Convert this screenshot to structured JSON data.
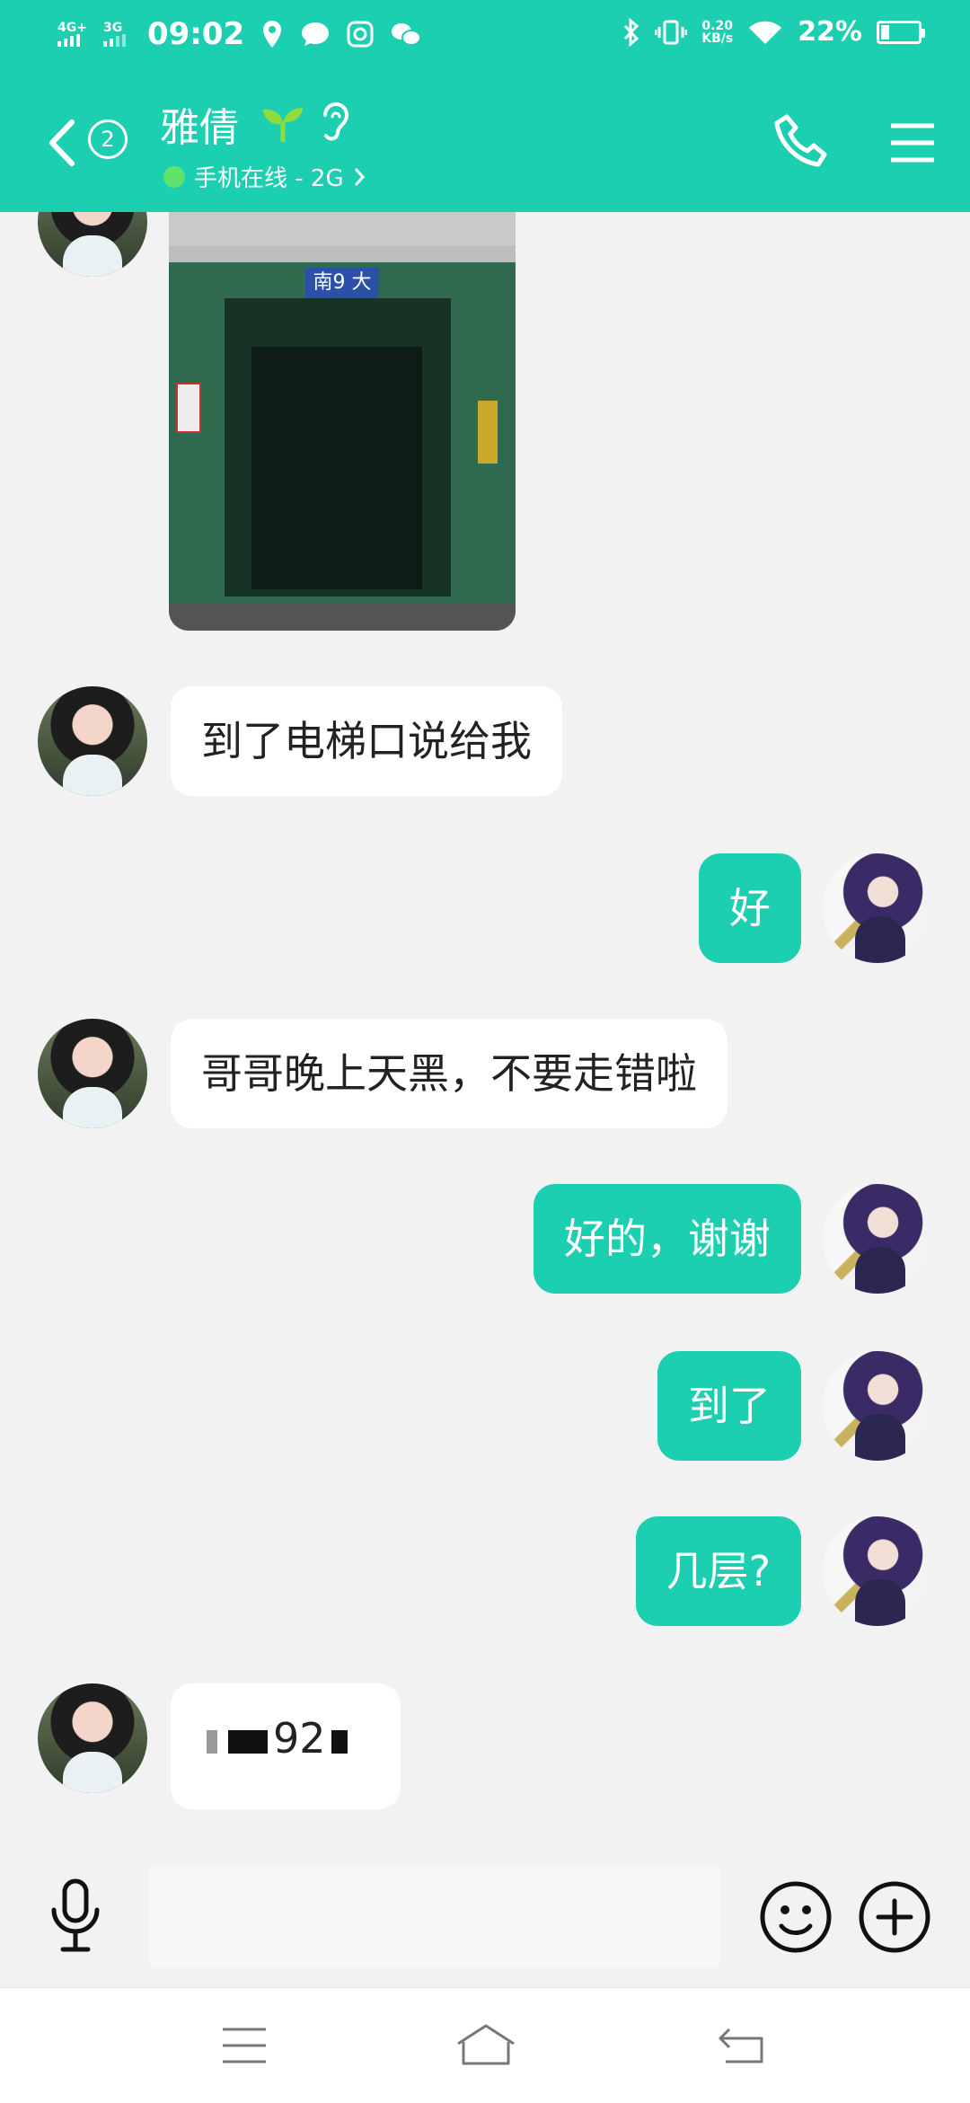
{
  "status_bar": {
    "network_1": "4G+",
    "network_2": "3G",
    "time": "09:02",
    "speed_value": "0.20",
    "speed_unit": "KB/s",
    "battery": "22%",
    "battery_level": 0.22
  },
  "header": {
    "unread_count": "2",
    "contact_name": "雅倩",
    "online_status": "手机在线 - 2G",
    "theme_color": "#1ccfb0"
  },
  "photo": {
    "sign_text": "南9 大"
  },
  "messages": [
    {
      "side": "incoming",
      "text": "到了电梯口说给我"
    },
    {
      "side": "outgoing",
      "text": "好"
    },
    {
      "side": "incoming",
      "text": "哥哥晚上天黑，不要走错啦"
    },
    {
      "side": "outgoing",
      "text": "好的，谢谢"
    },
    {
      "side": "outgoing",
      "text": "到了"
    },
    {
      "side": "outgoing",
      "text": "几层?"
    },
    {
      "side": "incoming",
      "text": "92"
    }
  ],
  "input_bar": {
    "value": "",
    "placeholder": ""
  },
  "icons": {
    "back": "chevron-left-icon",
    "sprout": "sprout-icon",
    "ear": "ear-icon",
    "phone": "phone-icon",
    "menu": "menu-icon",
    "mic": "microphone-icon",
    "emoji": "smiley-icon",
    "plus": "plus-circle-icon"
  }
}
